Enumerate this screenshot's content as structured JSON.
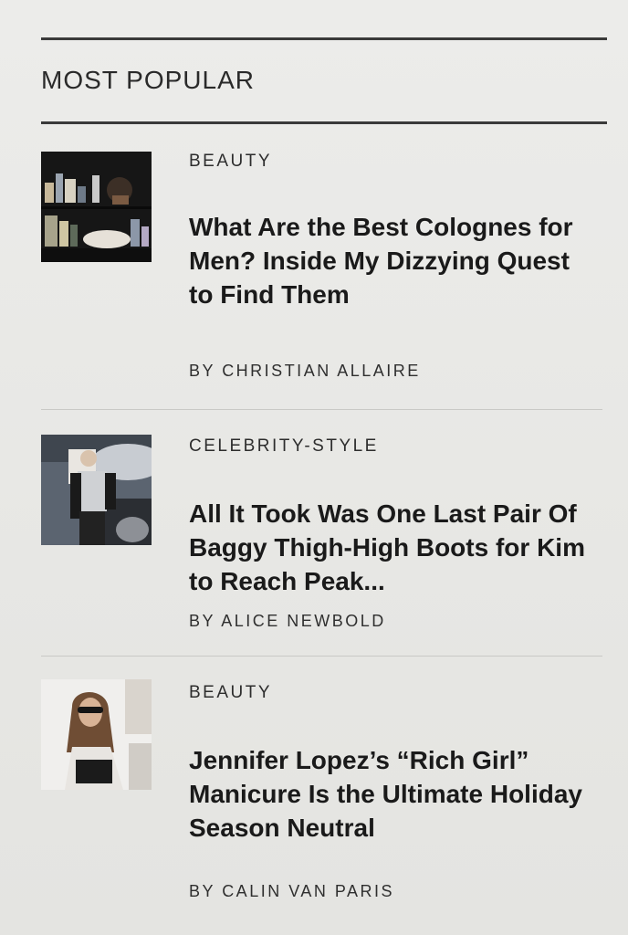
{
  "section": {
    "title": "MOST POPULAR"
  },
  "articles": [
    {
      "category": "BEAUTY",
      "headline": "What Are the Best Colognes for Men? Inside My Dizzying Quest to Find Them",
      "byline": "BY CHRISTIAN ALLAIRE",
      "thumbnail_icon": "cologne-bottles-thumbnail"
    },
    {
      "category": "CELEBRITY-STYLE",
      "headline": "All It Took Was One Last Pair Of Baggy Thigh-High Boots for Kim to Reach Peak...",
      "byline": "BY ALICE NEWBOLD",
      "thumbnail_icon": "celebrity-outfit-thumbnail"
    },
    {
      "category": "BEAUTY",
      "headline": "Jennifer Lopez’s “Rich Girl” Manicure Is the Ultimate Holiday Season Neutral",
      "byline": "BY CALIN VAN PARIS",
      "thumbnail_icon": "portrait-sunglasses-thumbnail"
    }
  ]
}
